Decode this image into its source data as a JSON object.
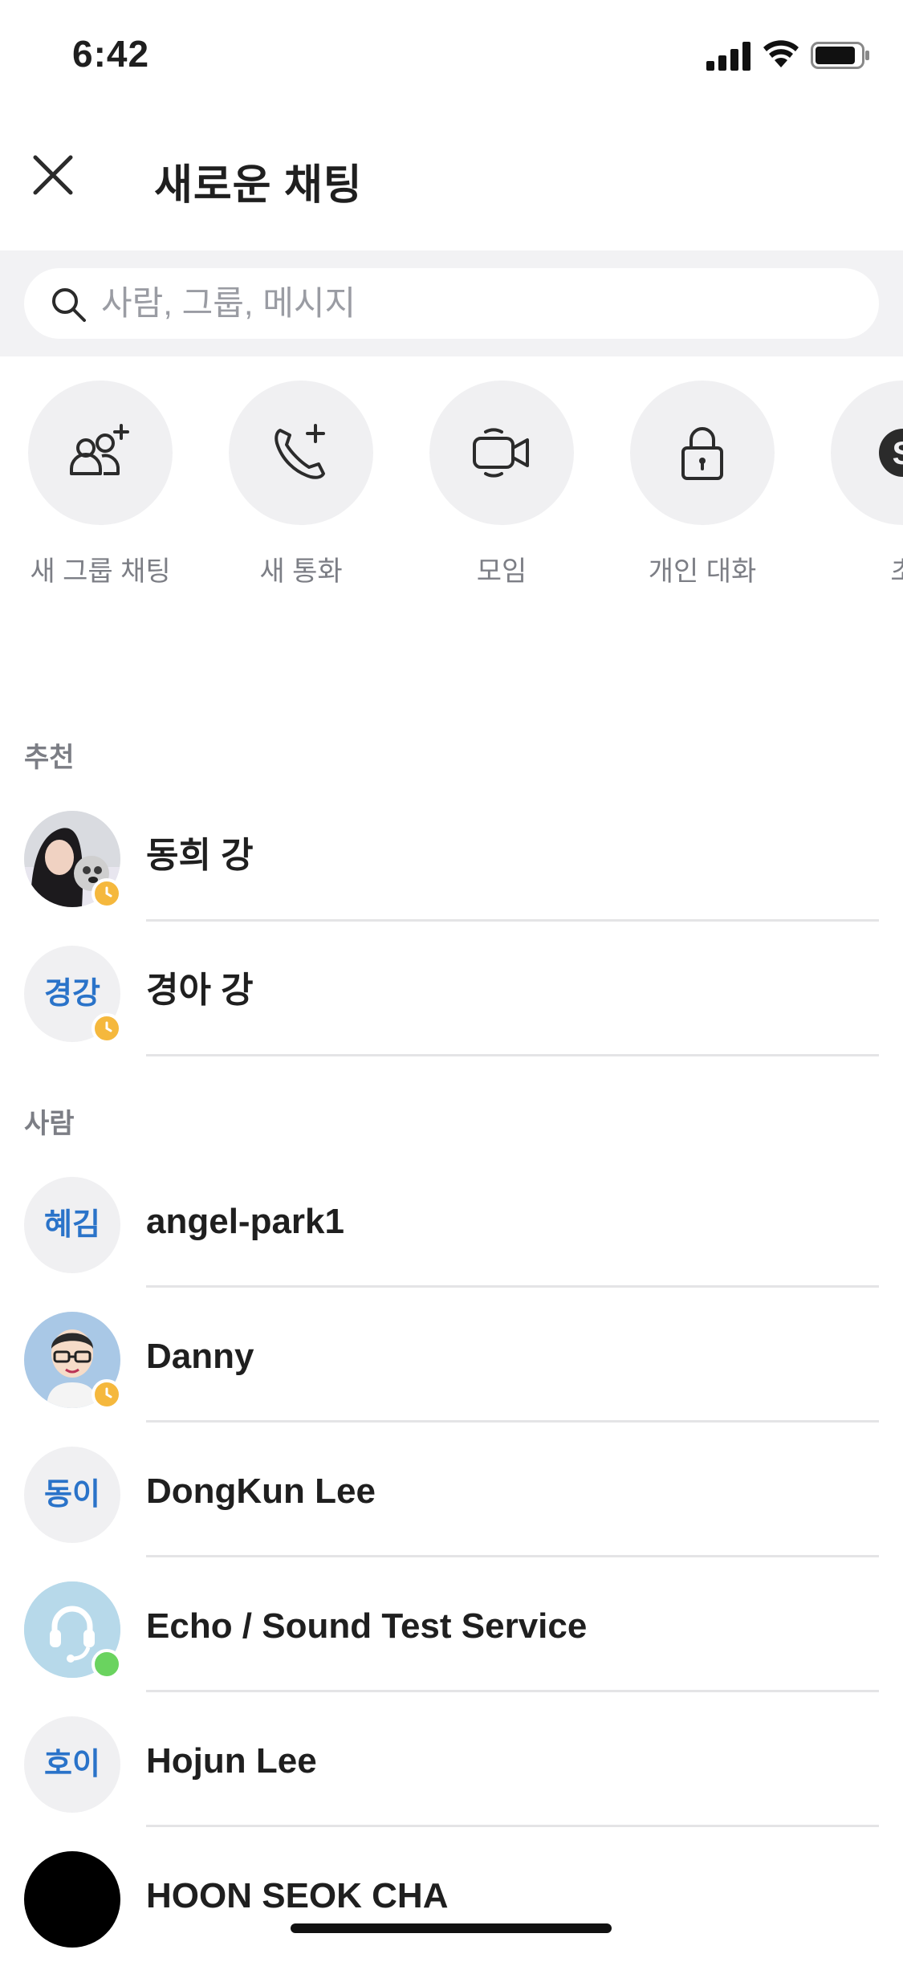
{
  "status_bar": {
    "time": "6:42"
  },
  "header": {
    "title": "새로운 채팅"
  },
  "search": {
    "placeholder": "사람, 그룹, 메시지"
  },
  "actions": [
    {
      "label": "새 그룹 채팅",
      "icon": "add-group-icon"
    },
    {
      "label": "새 통화",
      "icon": "add-call-icon"
    },
    {
      "label": "모임",
      "icon": "video-meeting-icon"
    },
    {
      "label": "개인 대화",
      "icon": "lock-icon"
    },
    {
      "label": "초",
      "icon": "skype-icon"
    }
  ],
  "sections": {
    "suggested": {
      "label": "추천",
      "contacts": [
        {
          "name": "동희 강",
          "initials": "",
          "presence": "away"
        },
        {
          "name": "경아 강",
          "initials": "경강",
          "presence": "away"
        }
      ]
    },
    "people": {
      "label": "사람",
      "contacts": [
        {
          "name": "angel-park1",
          "initials": "혜김",
          "presence": ""
        },
        {
          "name": "Danny",
          "initials": "",
          "presence": "away"
        },
        {
          "name": "DongKun Lee",
          "initials": "동이",
          "presence": ""
        },
        {
          "name": "Echo / Sound Test Service",
          "initials": "",
          "presence": "online"
        },
        {
          "name": "Hojun Lee",
          "initials": "호이",
          "presence": ""
        },
        {
          "name": "HOON SEOK CHA",
          "initials": "",
          "presence": ""
        }
      ]
    }
  },
  "colors": {
    "initials_text": "#2a73c9",
    "away": "#f5b83d",
    "online": "#6ad35f",
    "circle_bg": "#f0f0f2"
  }
}
